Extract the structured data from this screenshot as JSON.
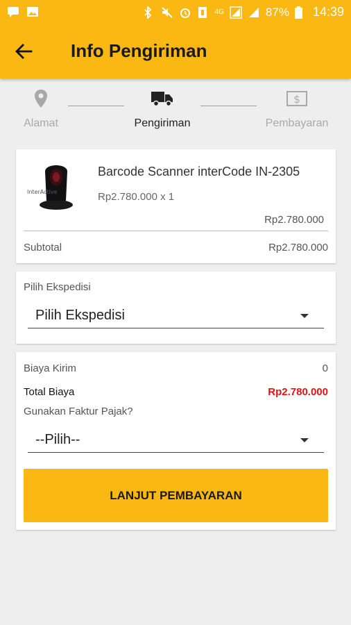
{
  "status_bar": {
    "battery": "87%",
    "time": "14:39",
    "network": "4G"
  },
  "header": {
    "title": "Info Pengiriman"
  },
  "stepper": {
    "steps": [
      {
        "label": "Alamat",
        "icon": "location-pin-icon",
        "active": false
      },
      {
        "label": "Pengiriman",
        "icon": "truck-icon",
        "active": true
      },
      {
        "label": "Pembayaran",
        "icon": "dollar-bill-icon",
        "active": false
      }
    ]
  },
  "order": {
    "product_name": "Barcode Scanner interCode IN-2305",
    "price_qty": "Rp2.780.000 x 1",
    "line_total": "Rp2.780.000",
    "subtotal_label": "Subtotal",
    "subtotal_value": "Rp2.780.000",
    "image_brand_text": "InterActive"
  },
  "shipping": {
    "label": "Pilih Ekspedisi",
    "selected": "Pilih Ekspedisi"
  },
  "summary": {
    "shipping_cost_label": "Biaya Kirim",
    "shipping_cost_value": "0",
    "total_label": "Total Biaya",
    "total_value": "Rp2.780.000",
    "tax_invoice_label": "Gunakan Faktur Pajak?",
    "tax_invoice_selected": "--Pilih--",
    "continue_button": "LANJUT PEMBAYARAN"
  },
  "colors": {
    "accent": "#fbb712",
    "total_red": "#e41212"
  }
}
